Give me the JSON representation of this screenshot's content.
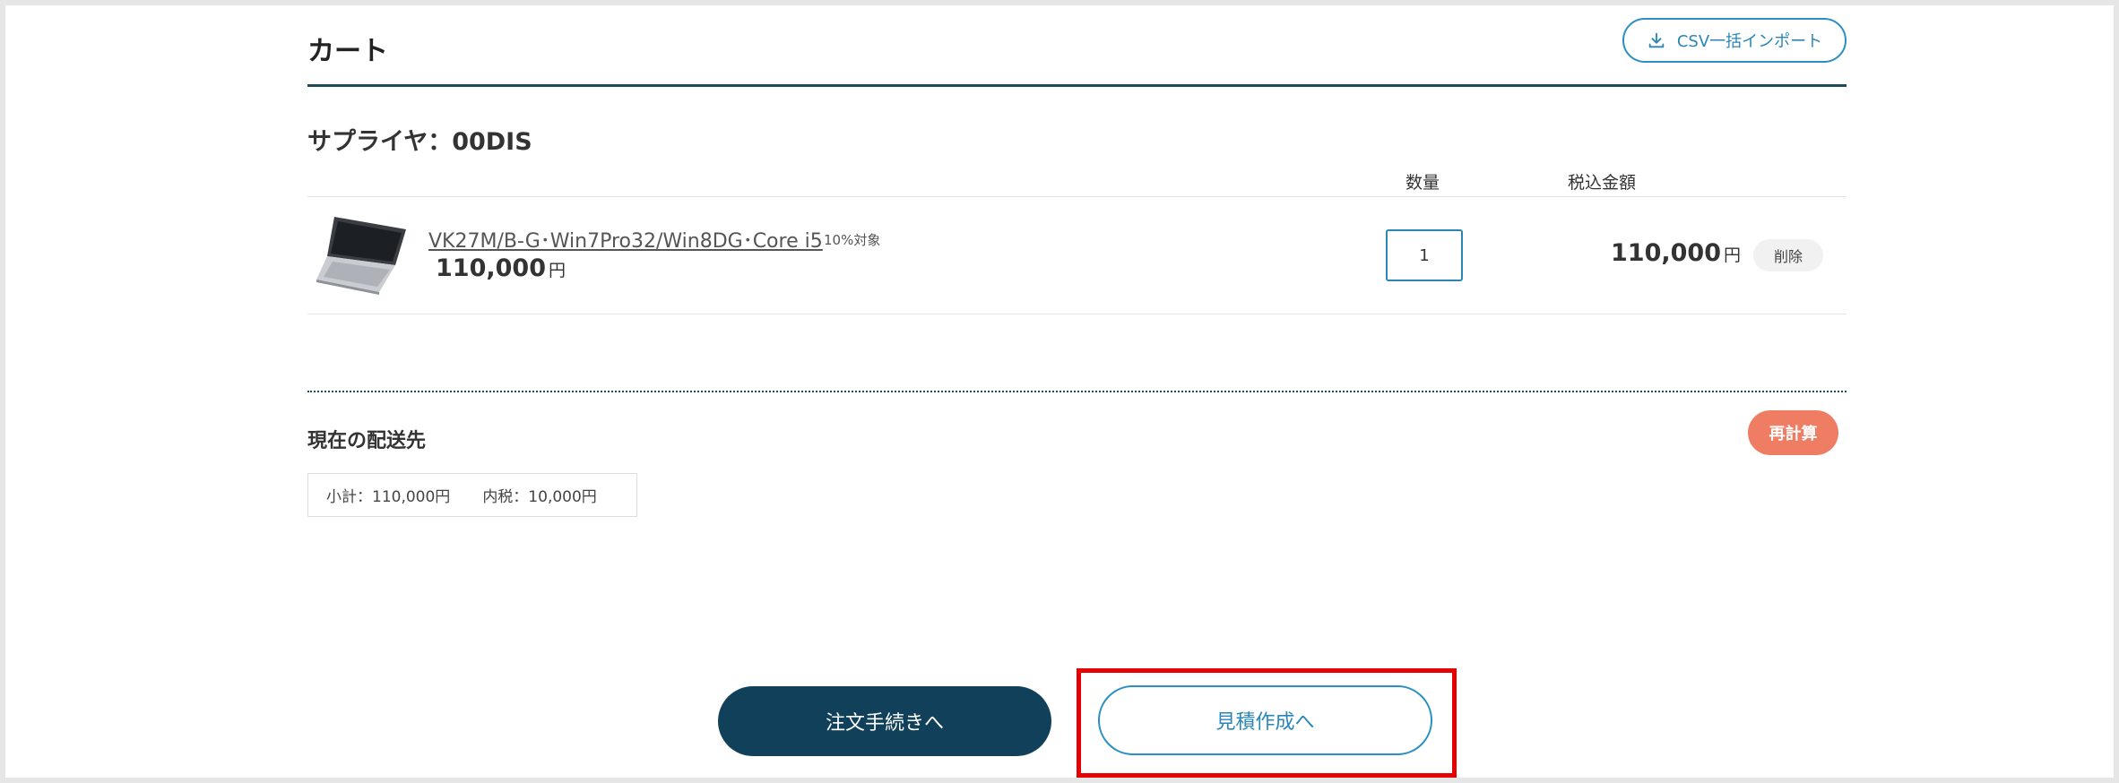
{
  "header": {
    "title": "カート",
    "csv_import_label": "CSV一括インポート"
  },
  "supplier": {
    "label": "サプライヤ：00DIS"
  },
  "columns": {
    "quantity": "数量",
    "price_incl_tax": "税込金額"
  },
  "item": {
    "name": "VK27M/B-G･Win7Pro32/Win8DG･Core i5",
    "tax_note": "10%対象",
    "unit_price": "110,000",
    "currency": "円",
    "quantity": "1",
    "total": "110,000",
    "delete_label": "削除"
  },
  "delivery": {
    "title": "現在の配送先",
    "recalc_label": "再計算",
    "subtotal": "小計：110,000円",
    "tax_included": "内税：10,000円"
  },
  "actions": {
    "order_label": "注文手続きへ",
    "quote_label": "見積作成へ"
  },
  "colors": {
    "primary": "#11405a",
    "accent": "#2a8fc2",
    "recalc": "#ef7d63",
    "highlight": "#e60000"
  }
}
